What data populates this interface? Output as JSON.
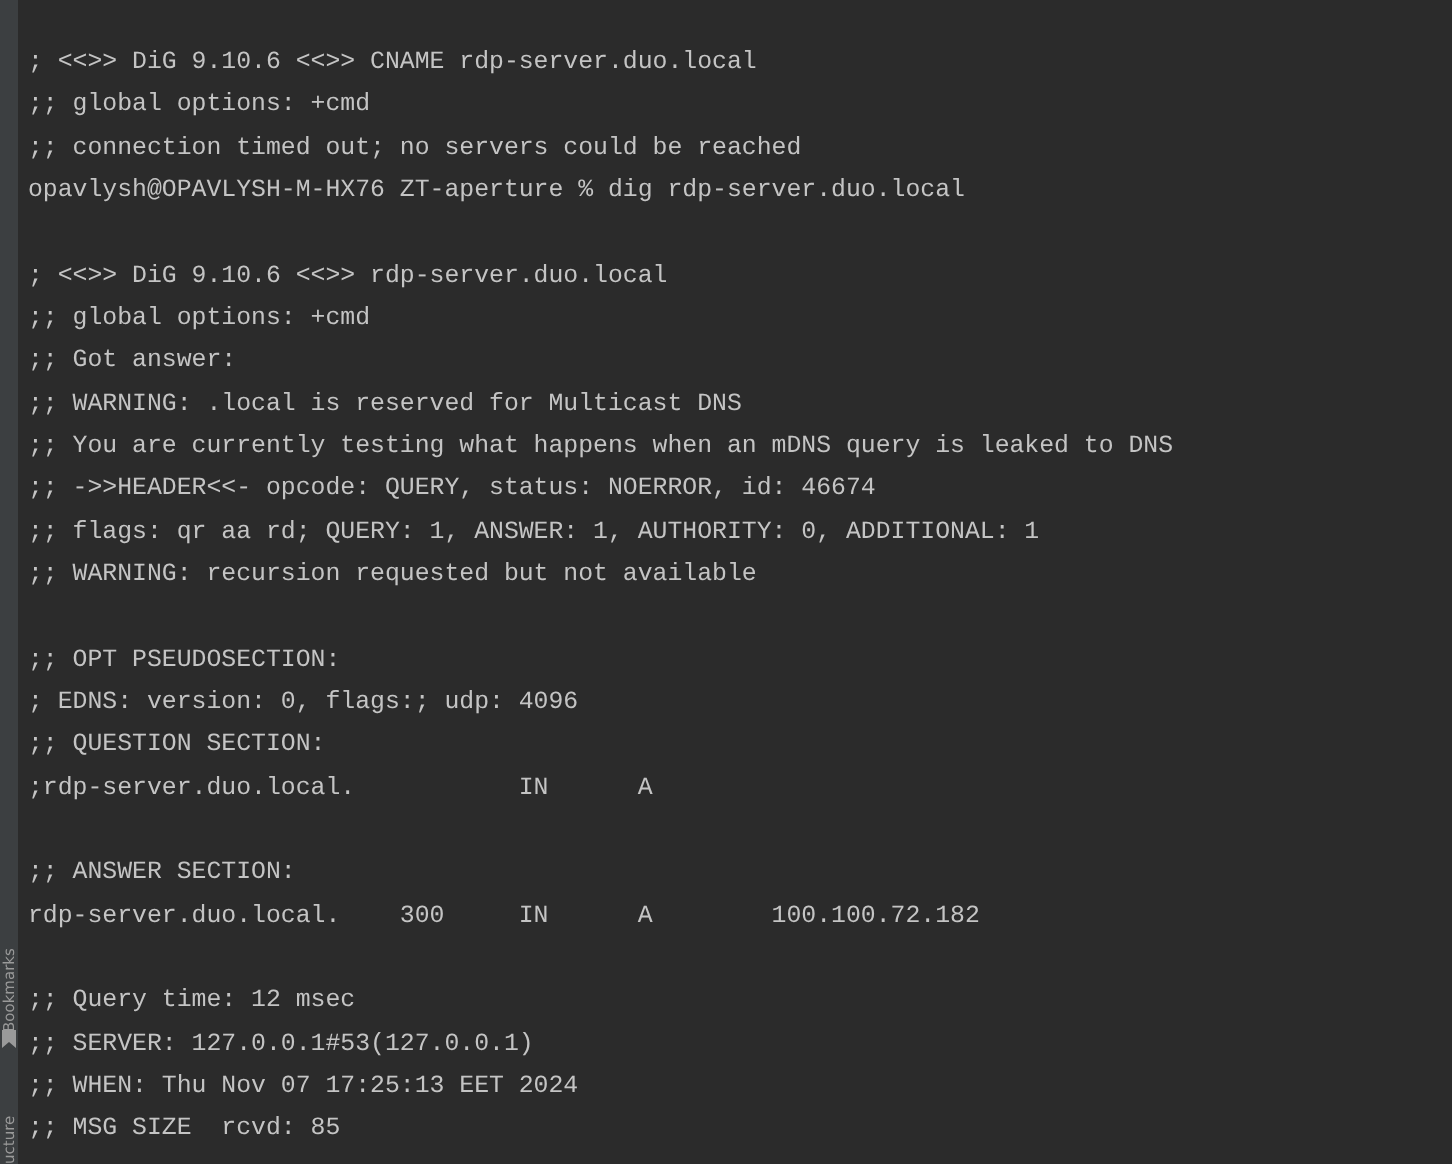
{
  "side_strip": {
    "labels": [
      "Bookmarks",
      "ucture"
    ]
  },
  "terminal": {
    "blocks": [
      [
        "; <<>> DiG 9.10.6 <<>> CNAME rdp-server.duo.local",
        ";; global options: +cmd",
        ";; connection timed out; no servers could be reached",
        "opavlysh@OPAVLYSH-M-HX76 ZT-aperture % dig rdp-server.duo.local"
      ],
      [
        "; <<>> DiG 9.10.6 <<>> rdp-server.duo.local",
        ";; global options: +cmd",
        ";; Got answer:",
        ";; WARNING: .local is reserved for Multicast DNS",
        ";; You are currently testing what happens when an mDNS query is leaked to DNS",
        ";; ->>HEADER<<- opcode: QUERY, status: NOERROR, id: 46674",
        ";; flags: qr aa rd; QUERY: 1, ANSWER: 1, AUTHORITY: 0, ADDITIONAL: 1",
        ";; WARNING: recursion requested but not available"
      ],
      [
        ";; OPT PSEUDOSECTION:",
        "; EDNS: version: 0, flags:; udp: 4096",
        ";; QUESTION SECTION:",
        ";rdp-server.duo.local.           IN      A"
      ],
      [
        ";; ANSWER SECTION:",
        "rdp-server.duo.local.    300     IN      A        100.100.72.182"
      ],
      [
        ";; Query time: 12 msec",
        ";; SERVER: 127.0.0.1#53(127.0.0.1)",
        ";; WHEN: Thu Nov 07 17:25:13 EET 2024",
        ";; MSG SIZE  rcvd: 85"
      ]
    ]
  }
}
